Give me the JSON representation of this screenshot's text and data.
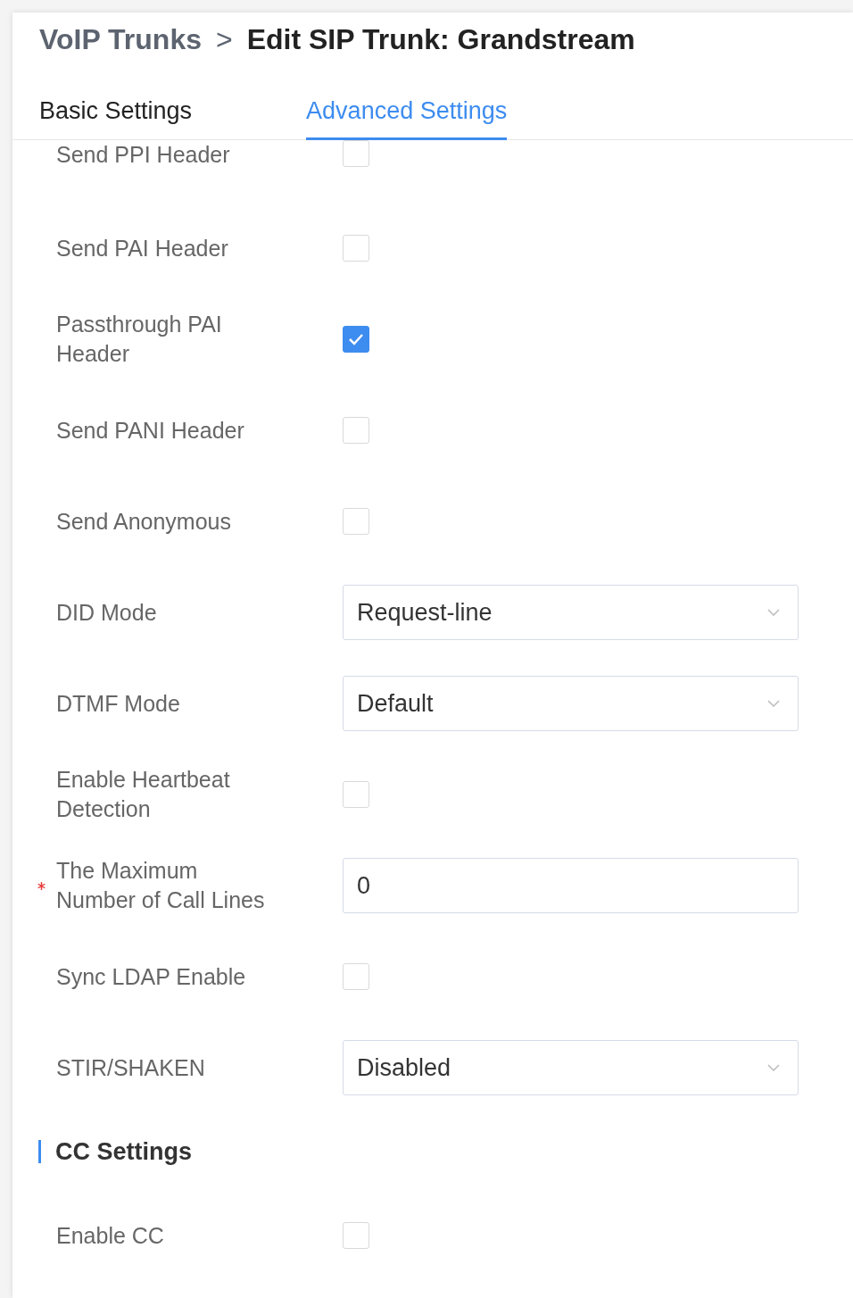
{
  "breadcrumb": {
    "parent": "VoIP Trunks",
    "separator": ">",
    "current": "Edit SIP Trunk: Grandstream"
  },
  "tabs": [
    {
      "label": "Basic Settings",
      "selected": false
    },
    {
      "label": "Advanced Settings",
      "selected": true
    }
  ],
  "fields": [
    {
      "kind": "checkbox",
      "label": "Send PPI Header",
      "checked": false
    },
    {
      "kind": "checkbox",
      "label": "Send PAI Header",
      "checked": false
    },
    {
      "kind": "checkbox",
      "label": "Passthrough PAI Header",
      "checked": true
    },
    {
      "kind": "checkbox",
      "label": "Send PANI Header",
      "checked": false
    },
    {
      "kind": "checkbox",
      "label": "Send Anonymous",
      "checked": false
    },
    {
      "kind": "select",
      "label": "DID Mode",
      "value": "Request-line"
    },
    {
      "kind": "select",
      "label": "DTMF Mode",
      "value": "Default"
    },
    {
      "kind": "checkbox",
      "label": "Enable Heartbeat Detection",
      "checked": false
    },
    {
      "kind": "input",
      "label": "The Maximum Number of Call Lines",
      "value": "0",
      "required": true
    },
    {
      "kind": "checkbox",
      "label": "Sync LDAP Enable",
      "checked": false
    },
    {
      "kind": "select",
      "label": "STIR/SHAKEN",
      "value": "Disabled"
    }
  ],
  "cc_section": {
    "title": "CC Settings",
    "fields": [
      {
        "kind": "checkbox",
        "label": "Enable CC",
        "checked": false
      }
    ]
  }
}
